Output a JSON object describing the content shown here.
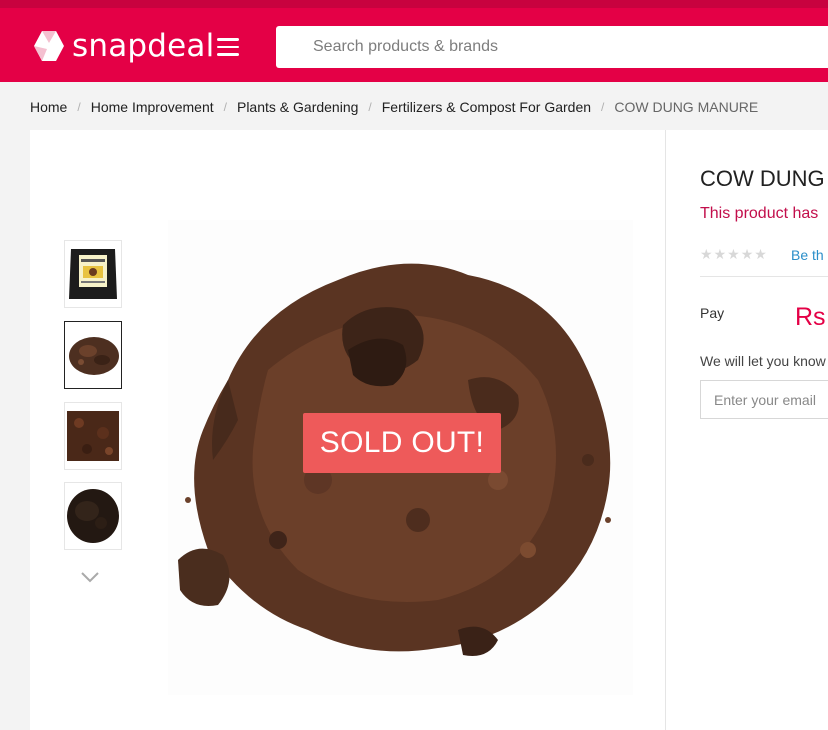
{
  "header": {
    "logo_text": "snapdeal",
    "search_placeholder": "Search products & brands",
    "brand_color": "#e40046"
  },
  "breadcrumb": [
    "Home",
    "Home Improvement",
    "Plants & Gardening",
    "Fertilizers & Compost For Garden",
    "COW DUNG MANURE"
  ],
  "product": {
    "title": "COW DUNG I",
    "availability_notice": "This product has",
    "rating_stars": 5,
    "review_link": "Be th",
    "pay_label": "Pay",
    "price_prefix": "Rs",
    "notify_text": "We will let you know",
    "email_placeholder": "Enter your email",
    "sold_out_label": "SOLD OUT!"
  },
  "thumbnails": [
    {
      "name": "package-thumbnail",
      "active": false
    },
    {
      "name": "dung-pile-thumbnail",
      "active": true
    },
    {
      "name": "dung-closeup-thumbnail",
      "active": false
    },
    {
      "name": "dung-dark-thumbnail",
      "active": false
    }
  ]
}
